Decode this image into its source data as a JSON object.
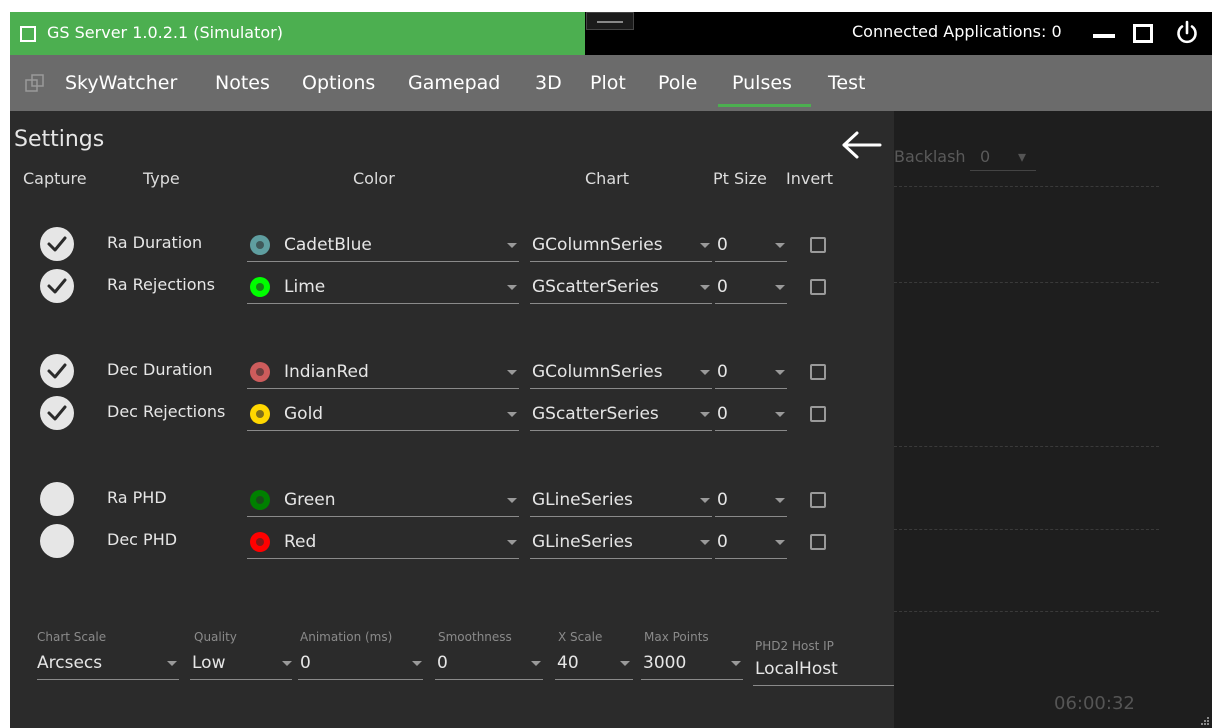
{
  "titlebar": {
    "app_title": "GS Server 1.0.2.1 (Simulator)",
    "connected_label": "Connected Applications: 0",
    "accent_color": "#4caf50"
  },
  "menu": {
    "items": [
      "SkyWatcher",
      "Notes",
      "Options",
      "Gamepad",
      "3D",
      "Plot",
      "Pole",
      "Pulses",
      "Test"
    ],
    "active": "Pulses"
  },
  "settings": {
    "title": "Settings",
    "columns": {
      "capture": "Capture",
      "type": "Type",
      "color": "Color",
      "chart": "Chart",
      "pt_size": "Pt Size",
      "invert": "Invert"
    },
    "rows": [
      {
        "captured": true,
        "type": "Ra Duration",
        "color": "CadetBlue",
        "swatch": "#5f9ea0",
        "chart": "GColumnSeries",
        "pt_size": "0",
        "invert": false
      },
      {
        "captured": true,
        "type": "Ra Rejections",
        "color": "Lime",
        "swatch": "#00ff00",
        "chart": "GScatterSeries",
        "pt_size": "0",
        "invert": false
      },
      {
        "captured": true,
        "type": "Dec Duration",
        "color": "IndianRed",
        "swatch": "#cd5c5c",
        "chart": "GColumnSeries",
        "pt_size": "0",
        "invert": false
      },
      {
        "captured": true,
        "type": "Dec Rejections",
        "color": "Gold",
        "swatch": "#ffd700",
        "chart": "GScatterSeries",
        "pt_size": "0",
        "invert": false
      },
      {
        "captured": false,
        "type": "Ra PHD",
        "color": "Green",
        "swatch": "#008000",
        "chart": "GLineSeries",
        "pt_size": "0",
        "invert": false
      },
      {
        "captured": false,
        "type": "Dec PHD",
        "color": "Red",
        "swatch": "#ff0000",
        "chart": "GLineSeries",
        "pt_size": "0",
        "invert": false
      }
    ],
    "bottom": {
      "chart_scale": {
        "label": "Chart Scale",
        "value": "Arcsecs"
      },
      "quality": {
        "label": "Quality",
        "value": "Low"
      },
      "animation": {
        "label": "Animation (ms)",
        "value": "0"
      },
      "smoothness": {
        "label": "Smoothness",
        "value": "0"
      },
      "x_scale": {
        "label": "X Scale",
        "value": "40"
      },
      "max_points": {
        "label": "Max Points",
        "value": "3000"
      },
      "phd2_host": {
        "label": "PHD2 Host IP",
        "value": "LocalHost"
      }
    }
  },
  "chart_panel": {
    "backlash_label": "Backlash",
    "backlash_value": "0",
    "time": "06:00:32"
  }
}
